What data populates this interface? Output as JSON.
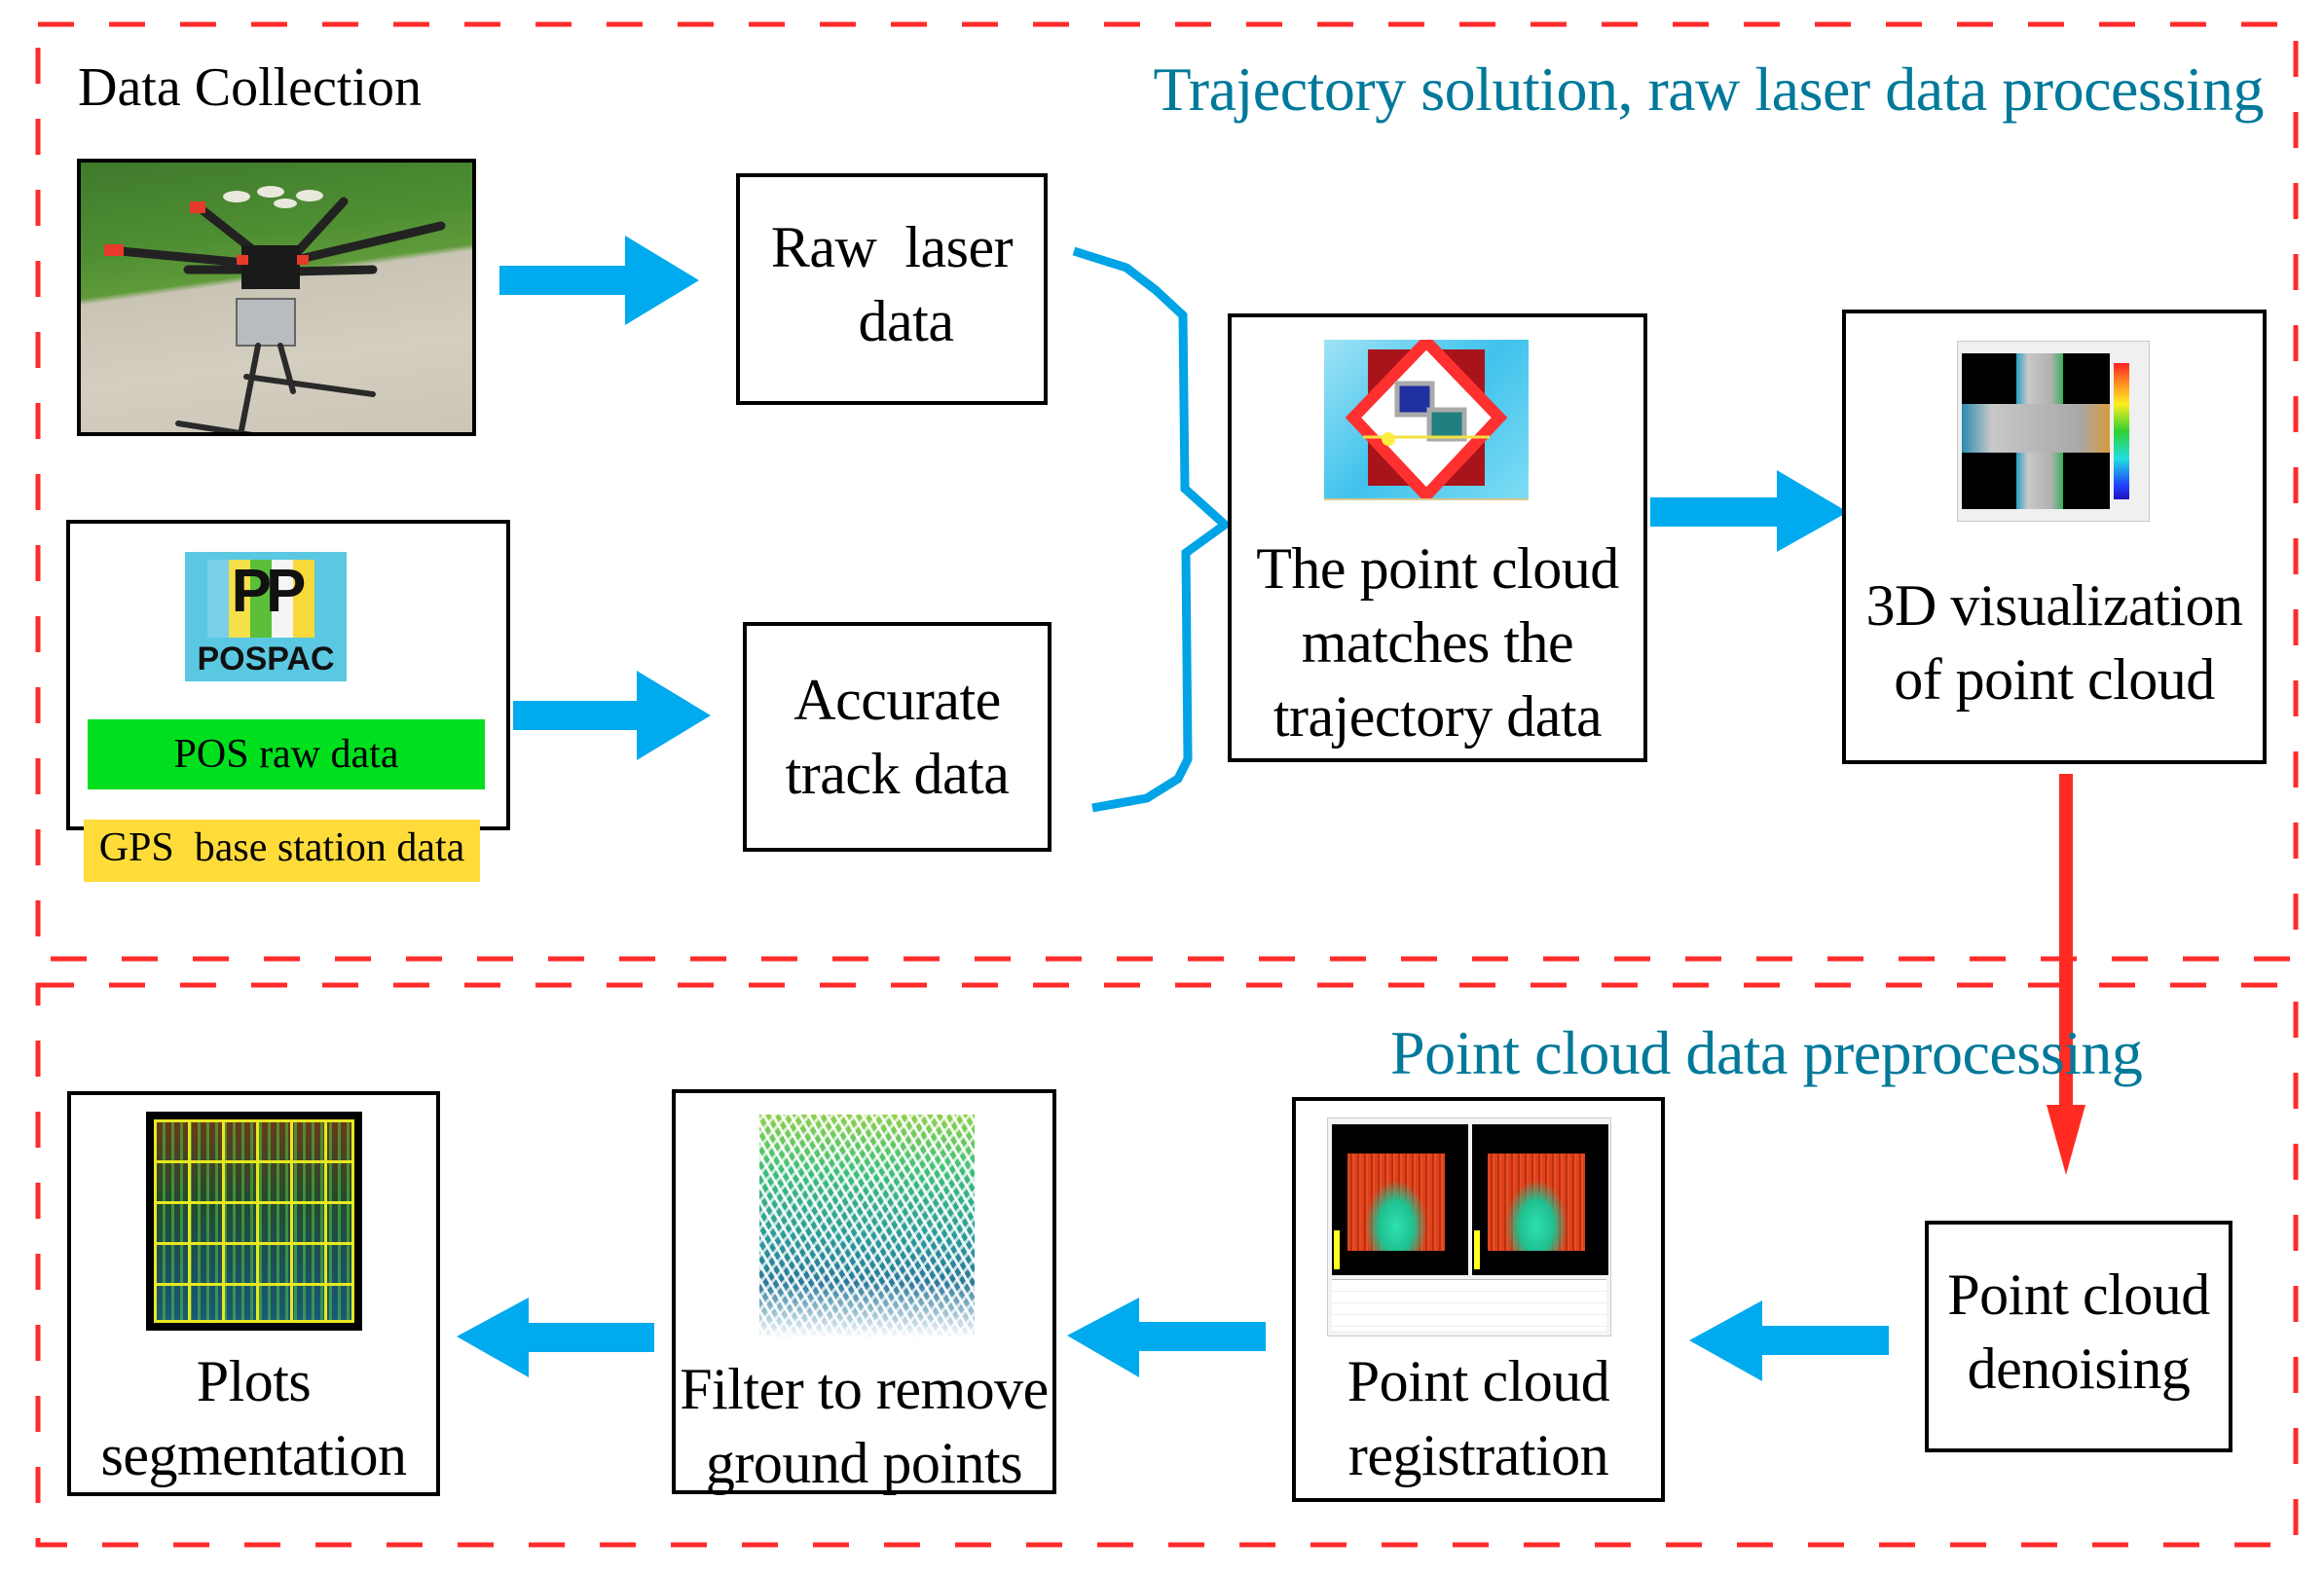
{
  "sections": {
    "top": {
      "label": "Data Collection",
      "title": "Trajectory solution, raw laser data processing"
    },
    "bottom": {
      "title": "Point cloud data preprocessing"
    }
  },
  "nodes": {
    "drone_photo": {
      "alt": "UAV hexacopter with LiDAR sensor"
    },
    "raw_laser": {
      "text": "Raw  laser\n  data"
    },
    "pospac": {
      "icon_letters": "PP",
      "icon_label": "POSPAC",
      "pos_raw": "POS raw data",
      "gps_base": "GPS  base station data"
    },
    "accurate_track": {
      "text": "Accurate\ntrack data"
    },
    "match": {
      "text": "The point cloud\nmatches the\ntrajectory data"
    },
    "visualization": {
      "text": "3D visualization\nof point cloud"
    },
    "denoising": {
      "text": "Point cloud\ndenoising"
    },
    "registration": {
      "text": "Point cloud\nregistration"
    },
    "filter": {
      "text": "Filter to remove\nground points"
    },
    "plots": {
      "text": "Plots\nsegmentation"
    }
  },
  "colors": {
    "section_border": "#ff2b2b",
    "section_title": "#00799a",
    "flow_arrow": "#00aaee",
    "transition_arrow": "#ff2b22",
    "pos_raw_band": "#00e01e",
    "gps_band": "#ffdc3a"
  }
}
